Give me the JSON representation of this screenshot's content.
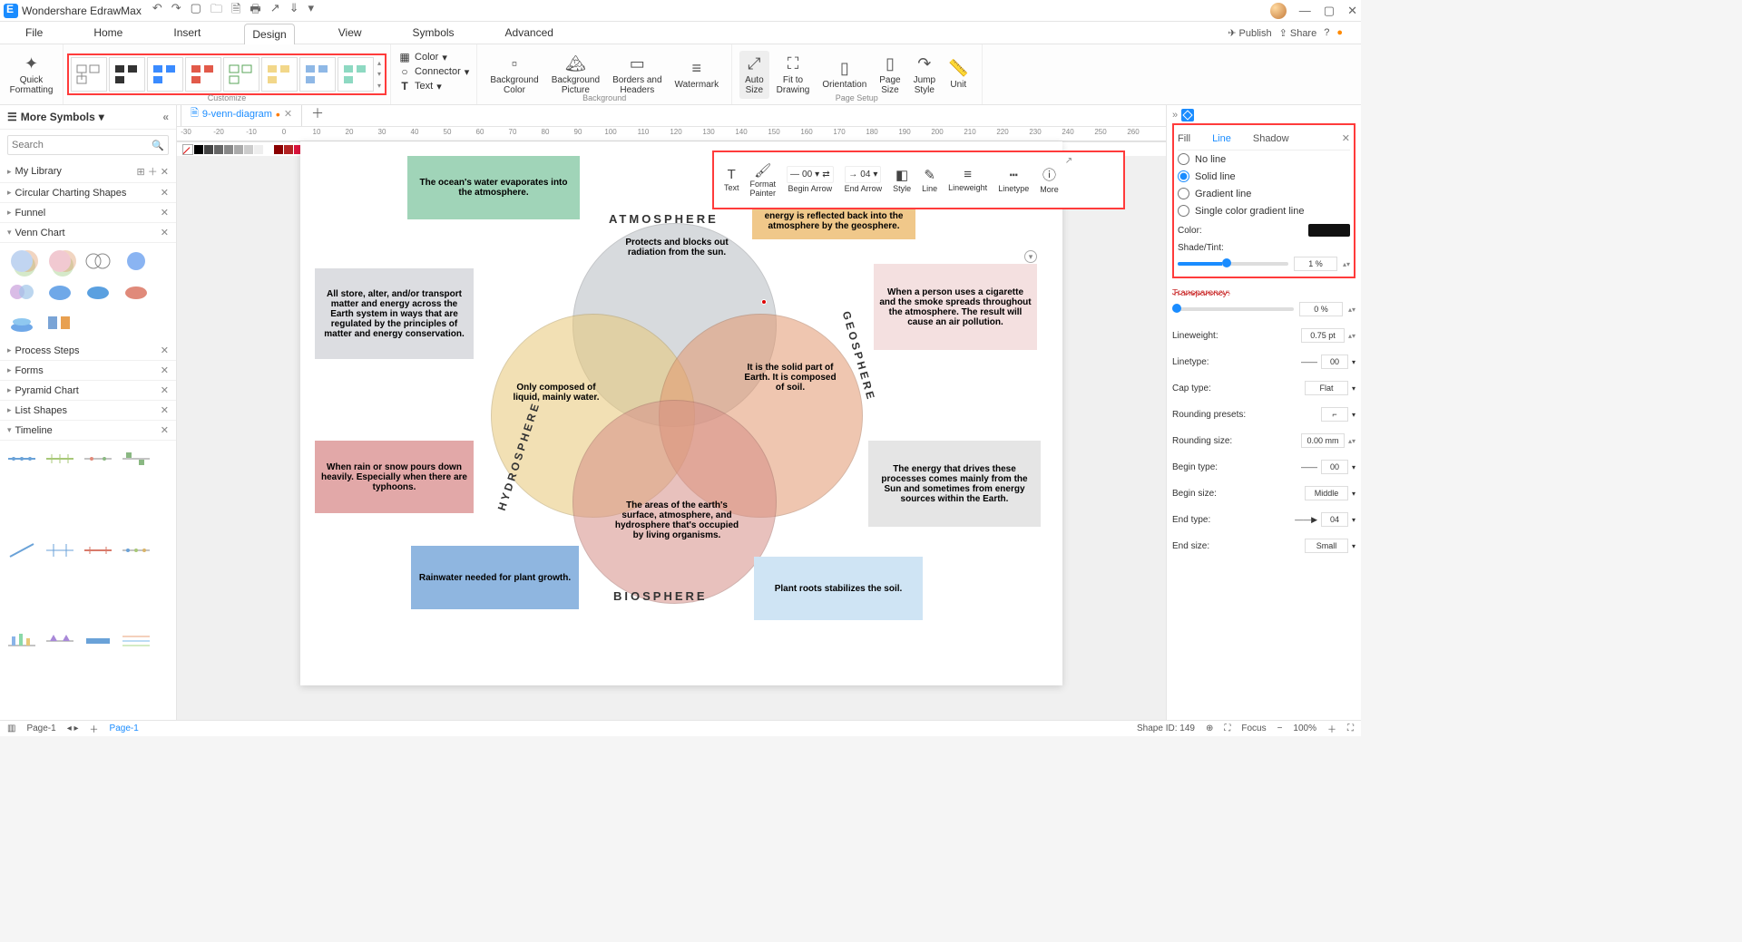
{
  "app": {
    "name": "Wondershare EdrawMax"
  },
  "menus": [
    "File",
    "Home",
    "Insert",
    "Design",
    "View",
    "Symbols",
    "Advanced"
  ],
  "activeMenu": "Design",
  "titleActions": {
    "publish": "Publish",
    "share": "Share"
  },
  "ribbon": {
    "quickFmt": "Quick\nFormatting",
    "colorMenu": "Color",
    "connectorMenu": "Connector",
    "textMenu": "Text",
    "bgColor": "Background\nColor",
    "bgPic": "Background\nPicture",
    "bh": "Borders and\nHeaders",
    "wm": "Watermark",
    "autosize": "Auto\nSize",
    "fit": "Fit to\nDrawing",
    "orient": "Orientation",
    "psize": "Page\nSize",
    "jump": "Jump\nStyle",
    "unit": "Unit",
    "groupCustomize": "Customize",
    "groupBackground": "Background",
    "groupPageSetup": "Page Setup"
  },
  "leftPanel": {
    "title": "More Symbols",
    "searchPlaceholder": "Search",
    "sections": [
      "My Library",
      "Circular Charting Shapes",
      "Funnel",
      "Venn Chart",
      "Process Steps",
      "Forms",
      "Pyramid Chart",
      "List Shapes",
      "Timeline"
    ]
  },
  "fileTab": {
    "name": "9-venn-diagram"
  },
  "floatTB": {
    "text": "Text",
    "fmt": "Format\nPainter",
    "begin": "Begin Arrow",
    "end": "End Arrow",
    "style": "Style",
    "line": "Line",
    "lw": "Lineweight",
    "lt": "Linetype",
    "more": "More",
    "beginVal": "00",
    "endVal": "04"
  },
  "venn": {
    "top": "Protects and blocks out radiation from the sun.",
    "left": "Only composed of liquid, mainly water.",
    "right": "It is the solid part of Earth. It is composed of soil.",
    "bottom": "The areas of the earth's surface, atmosphere, and hydrosphere that's occupied by living organisms.",
    "tOcean": "The ocean's water evaporates into the atmosphere.",
    "tGeo": "energy is reflected back into the atmosphere by the geosphere.",
    "tAll": "All store, alter, and/or transport matter and energy across the Earth system in ways that are regulated by the principles of matter and energy conservation.",
    "tCig": "When a person uses a cigarette and the smoke spreads throughout the atmosphere. The result will cause an air pollution.",
    "tRain": "When rain or snow pours down heavily. Especially when there are typhoons.",
    "tEnergy": "The energy that drives these processes comes mainly from the Sun and sometimes from energy sources within the Earth.",
    "tRainwater": "Rainwater needed for plant growth.",
    "tRoots": "Plant roots stabilizes the soil.",
    "labTop": "ATMOSPHERE",
    "labLeft": "HYDROSPHERE",
    "labRight": "GEOSPHERE",
    "labBottom": "BIOSPHERE"
  },
  "rightPanel": {
    "tabs": [
      "Fill",
      "Line",
      "Shadow"
    ],
    "activeTab": "Line",
    "radios": [
      "No line",
      "Solid line",
      "Gradient line",
      "Single color gradient line"
    ],
    "selectedRadio": "Solid line",
    "color": "Color:",
    "shade": "Shade/Tint:",
    "shadeVal": "1 %",
    "transp": "Transparency:",
    "transpVal": "0 %",
    "lw": "Lineweight:",
    "lwVal": "0.75 pt",
    "lt": "Linetype:",
    "ltVal": "00",
    "cap": "Cap type:",
    "capVal": "Flat",
    "rp": "Rounding presets:",
    "rs": "Rounding size:",
    "rsVal": "0.00 mm",
    "bt": "Begin type:",
    "btVal": "00",
    "bs": "Begin size:",
    "bsVal": "Middle",
    "et": "End type:",
    "etVal": "04",
    "es": "End size:",
    "esVal": "Small"
  },
  "status": {
    "pageBtn": "Page-1",
    "pageTab": "Page-1",
    "shapeId": "Shape ID: 149",
    "focus": "Focus",
    "zoom": "100%"
  },
  "rulerMarks": [
    -30,
    -20,
    -10,
    0,
    10,
    20,
    30,
    40,
    50,
    60,
    70,
    80,
    90,
    100,
    110,
    120,
    130,
    140,
    150,
    160,
    170,
    180,
    190,
    200,
    210,
    220,
    230,
    240,
    250,
    260
  ]
}
